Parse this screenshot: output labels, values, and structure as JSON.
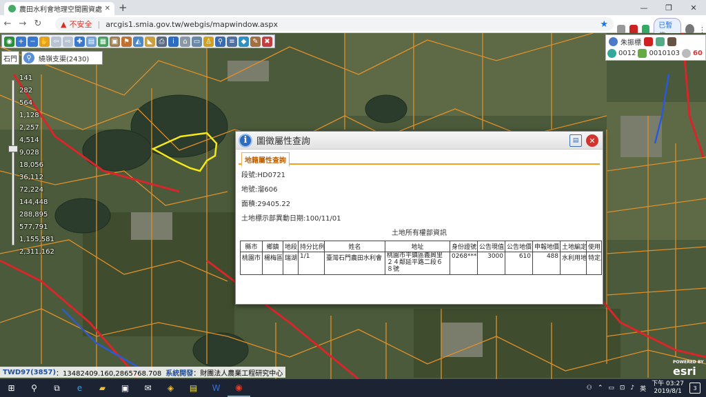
{
  "browser": {
    "tab_title": "農田水利會地理空間圖資處理平台",
    "insecure_label": "不安全",
    "url": "arcgis1.smia.gov.tw/webgis/mapwindow.aspx",
    "paused_label": "已暫停"
  },
  "map": {
    "region_select": "石門",
    "search_placeholder": "繞嶺支渠(2430)",
    "scale_labels": [
      "141",
      "282",
      "564",
      "1,128",
      "2,257",
      "4,514",
      "9,028",
      "18,056",
      "36,112",
      "72,224",
      "144,448",
      "288,895",
      "577,791",
      "1,155,581",
      "2,311,162"
    ],
    "colors": {
      "parcel": "#e0902a",
      "road": "#d8262a",
      "canal": "#2a5ad8",
      "highlight": "#f5e81a"
    }
  },
  "user_panel": {
    "user_name": "朱振標",
    "count_a": "0012",
    "count_b": "0010103",
    "timer": "60"
  },
  "dialog": {
    "title": "圖徵屬性查詢",
    "tab_label": "地籍屬性查詢",
    "section_no": "段號:HD0721",
    "lot_no": "地號:溜606",
    "area": "面積:29405.22",
    "change_date": "土地標示部異動日期:100/11/01",
    "owner_title": "土地所有權部資訊",
    "headers": [
      "縣市",
      "鄉鎮",
      "地段",
      "持分比例",
      "姓名",
      "地址",
      "身份證號",
      "公告現值",
      "公告地價",
      "申報地價",
      "土地編定",
      "使用"
    ],
    "row": [
      "桃園市",
      "楊梅區",
      "瑞湖",
      "1/1",
      "臺灣石門農田水利會",
      "桃園市平鎮區義興里２４鄰延平路二段６８號",
      "0268****",
      "3000",
      "610",
      "488",
      "水利用地",
      "特定農"
    ]
  },
  "statusbar": {
    "projection": "TWD97(3857)",
    "coords": "：13482409.160,2865768.708",
    "dev_label": "系統開發",
    "dev_org": "：財團法人農業工程研究中心"
  },
  "brand": {
    "powered": "POWERED BY",
    "name": "esri"
  },
  "taskbar": {
    "time": "下午 03:27",
    "date": "2019/8/1",
    "notif_count": "3"
  }
}
